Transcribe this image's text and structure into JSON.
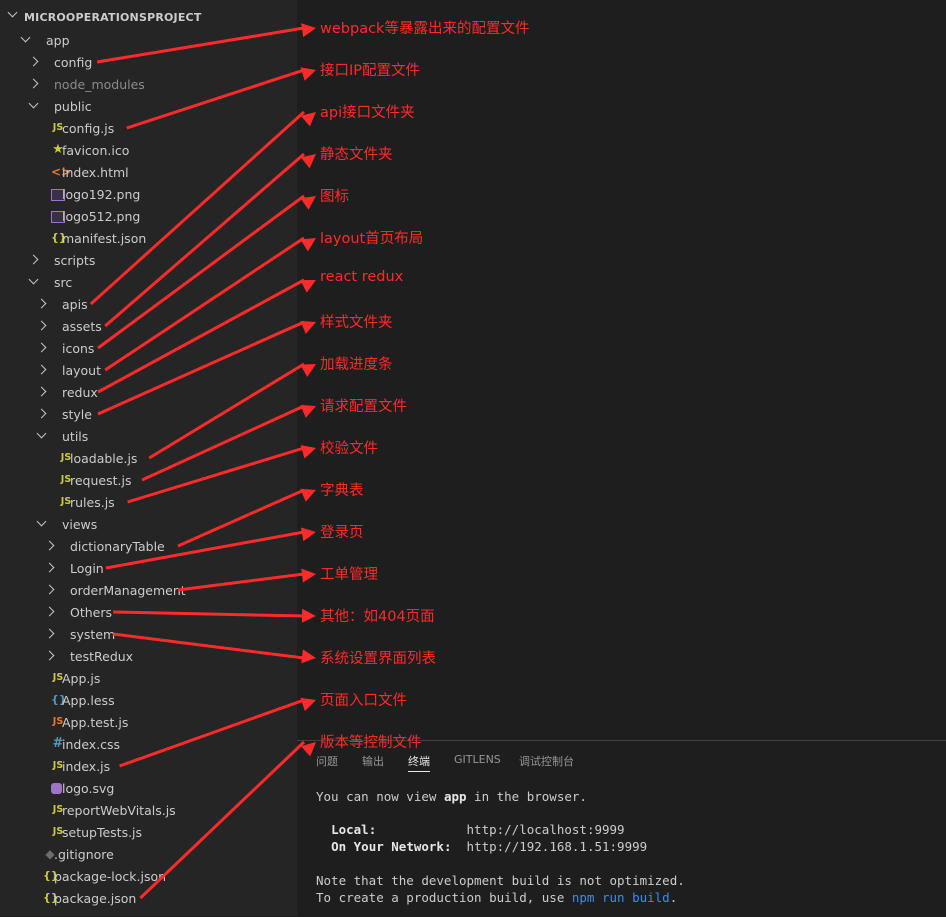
{
  "explorer": {
    "project_title": "MICROOPERATIONSPROJECT",
    "tree": [
      {
        "label": "app",
        "type": "folder",
        "state": "open"
      },
      {
        "label": "config",
        "type": "folder",
        "state": "closed"
      },
      {
        "label": "node_modules",
        "type": "folder",
        "state": "closed",
        "dim": true
      },
      {
        "label": "public",
        "type": "folder",
        "state": "open"
      },
      {
        "label": "config.js",
        "type": "file",
        "icon": "js-icon"
      },
      {
        "label": "favicon.ico",
        "type": "file",
        "icon": "star-icon"
      },
      {
        "label": "index.html",
        "type": "file",
        "icon": "html-icon"
      },
      {
        "label": "logo192.png",
        "type": "file",
        "icon": "image-icon"
      },
      {
        "label": "logo512.png",
        "type": "file",
        "icon": "image-icon"
      },
      {
        "label": "manifest.json",
        "type": "file",
        "icon": "json-icon"
      },
      {
        "label": "scripts",
        "type": "folder",
        "state": "closed"
      },
      {
        "label": "src",
        "type": "folder",
        "state": "open"
      },
      {
        "label": "apis",
        "type": "folder",
        "state": "closed"
      },
      {
        "label": "assets",
        "type": "folder",
        "state": "closed"
      },
      {
        "label": "icons",
        "type": "folder",
        "state": "closed"
      },
      {
        "label": "layout",
        "type": "folder",
        "state": "closed"
      },
      {
        "label": "redux",
        "type": "folder",
        "state": "closed"
      },
      {
        "label": "style",
        "type": "folder",
        "state": "closed"
      },
      {
        "label": "utils",
        "type": "folder",
        "state": "open"
      },
      {
        "label": "loadable.js",
        "type": "file",
        "icon": "js-icon"
      },
      {
        "label": "request.js",
        "type": "file",
        "icon": "js-icon"
      },
      {
        "label": "rules.js",
        "type": "file",
        "icon": "js-icon"
      },
      {
        "label": "views",
        "type": "folder",
        "state": "open"
      },
      {
        "label": "dictionaryTable",
        "type": "folder",
        "state": "closed"
      },
      {
        "label": "Login",
        "type": "folder",
        "state": "closed"
      },
      {
        "label": "orderManagement",
        "type": "folder",
        "state": "closed"
      },
      {
        "label": "Others",
        "type": "folder",
        "state": "closed"
      },
      {
        "label": "system",
        "type": "folder",
        "state": "closed"
      },
      {
        "label": "testRedux",
        "type": "folder",
        "state": "closed"
      },
      {
        "label": "App.js",
        "type": "file",
        "icon": "js-icon"
      },
      {
        "label": "App.less",
        "type": "file",
        "icon": "less-icon"
      },
      {
        "label": "App.test.js",
        "type": "file",
        "icon": "js-test-icon"
      },
      {
        "label": "index.css",
        "type": "file",
        "icon": "css-icon"
      },
      {
        "label": "index.js",
        "type": "file",
        "icon": "js-icon"
      },
      {
        "label": "logo.svg",
        "type": "file",
        "icon": "svg-icon"
      },
      {
        "label": "reportWebVitals.js",
        "type": "file",
        "icon": "js-icon"
      },
      {
        "label": "setupTests.js",
        "type": "file",
        "icon": "js-icon"
      },
      {
        "label": ".gitignore",
        "type": "file",
        "icon": "git-icon"
      },
      {
        "label": "package-lock.json",
        "type": "file",
        "icon": "json-icon"
      },
      {
        "label": "package.json",
        "type": "file",
        "icon": "json-icon"
      }
    ],
    "icon_glyphs": {
      "js": "JS",
      "json": "{}",
      "less": "{}",
      "css": "#",
      "html": "<>",
      "star": "★",
      "git": "◆"
    }
  },
  "annotations": [
    "webpack等暴露出来的配置文件",
    "接口IP配置文件",
    "api接口文件夹",
    "静态文件夹",
    "图标",
    "layout首页布局",
    "react redux",
    "样式文件夹",
    "加载进度条",
    "请求配置文件",
    "校验文件",
    "字典表",
    "登录页",
    "工单管理",
    "其他：如404页面",
    "系统设置界面列表",
    "页面入口文件",
    "版本等控制文件"
  ],
  "annotation_color": "#ff2a2a",
  "panel": {
    "tabs": [
      "问题",
      "输出",
      "终端",
      "GITLENS",
      "调试控制台"
    ],
    "active_tab": "终端",
    "terminal": {
      "line1": "You can now view ",
      "app_name": "app",
      "line1_end": " in the browser.",
      "local_label": "Local:",
      "local_url": "http://localhost:9999",
      "network_label": "On Your Network:",
      "network_url": "http://192.168.1.51:9999",
      "note_line": "Note that the development build is not optimized.",
      "build_prefix": "To create a production build, use ",
      "build_cmd": "npm run build",
      "build_suffix": "."
    }
  },
  "colors": {
    "sidebar_bg": "#252526",
    "editor_bg": "#1e1e1e",
    "link": "#3b8eea"
  }
}
